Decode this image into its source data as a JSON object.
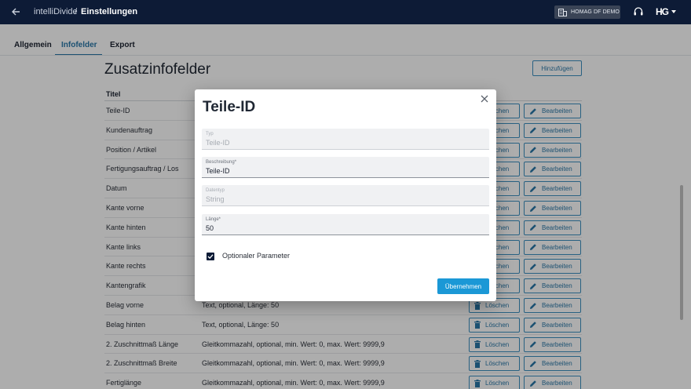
{
  "header": {
    "app_name": "intelliDivide",
    "separator": "/",
    "page": "Einstellungen",
    "org_name": "HOMAG DF DEMO",
    "user_logo": "HG"
  },
  "tabs": [
    {
      "label": "Allgemein",
      "active": false
    },
    {
      "label": "Infofelder",
      "active": true
    },
    {
      "label": "Export",
      "active": false
    }
  ],
  "main": {
    "title": "Zusatzinfofelder",
    "add_label": "Hinzufügen",
    "column_title": "Titel",
    "delete_label": "Löschen",
    "edit_label": "Bearbeiten",
    "rows": [
      {
        "title": "Teile-ID",
        "desc": ""
      },
      {
        "title": "Kundenauftrag",
        "desc": ""
      },
      {
        "title": "Position / Artikel",
        "desc": ""
      },
      {
        "title": "Fertigungsauftrag / Los",
        "desc": ""
      },
      {
        "title": "Datum",
        "desc": ""
      },
      {
        "title": "Kante vorne",
        "desc": ""
      },
      {
        "title": "Kante hinten",
        "desc": ""
      },
      {
        "title": "Kante links",
        "desc": ""
      },
      {
        "title": "Kante rechts",
        "desc": ""
      },
      {
        "title": "Kantengrafik",
        "desc": ""
      },
      {
        "title": "Belag vorne",
        "desc": "Text, optional, Länge: 50"
      },
      {
        "title": "Belag hinten",
        "desc": "Text, optional, Länge: 50"
      },
      {
        "title": "2. Zuschnittmaß Länge",
        "desc": "Gleitkommazahl, optional, min. Wert: 0, max. Wert: 9999,9"
      },
      {
        "title": "2. Zuschnittmaß Breite",
        "desc": "Gleitkommazahl, optional, min. Wert: 0, max. Wert: 9999,9"
      },
      {
        "title": "Fertiglänge",
        "desc": "Gleitkommazahl, optional, min. Wert: 0, max. Wert: 9999,9"
      }
    ]
  },
  "dialog": {
    "title": "Teile-ID",
    "fields": [
      {
        "label": "Typ",
        "value": "Teile-ID",
        "disabled": true
      },
      {
        "label": "Beschreibung*",
        "value": "Teile-ID",
        "disabled": false
      },
      {
        "label": "Datentyp",
        "value": "String",
        "disabled": true
      },
      {
        "label": "Länge*",
        "value": "50",
        "disabled": false
      }
    ],
    "checkbox_label": "Optionaler Parameter",
    "checkbox_checked": true,
    "submit_label": "Übernehmen"
  },
  "colors": {
    "topbar": "#0d1b36",
    "accent": "#2a78a8",
    "primary_button": "#1b98d6"
  }
}
